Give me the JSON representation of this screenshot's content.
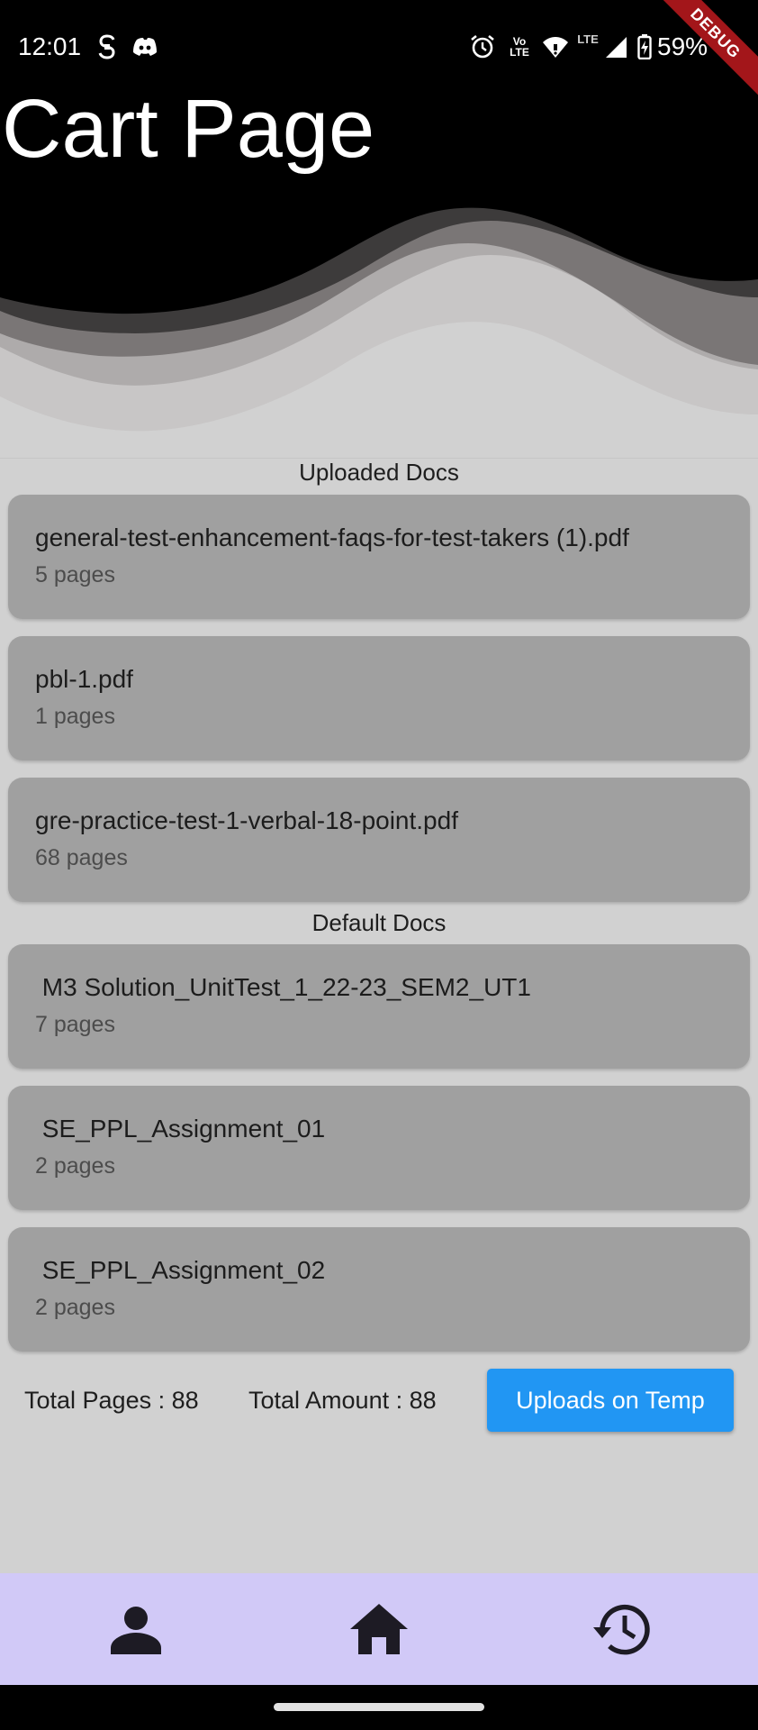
{
  "status_bar": {
    "time": "12:01",
    "battery": "59%",
    "debug_label": "DEBUG",
    "icons": [
      "s-notification-icon",
      "discord-icon",
      "alarm-icon",
      "volte-icon",
      "wifi-icon",
      "lte-icon",
      "signal-icon",
      "battery-charging-icon"
    ],
    "volte_line1": "Vo",
    "volte_line2": "LTE",
    "lte_label": "LTE"
  },
  "header": {
    "title": "Cart Page"
  },
  "uploaded": {
    "heading": "Uploaded Docs",
    "docs": [
      {
        "name": "general-test-enhancement-faqs-for-test-takers (1).pdf",
        "pages": "5 pages"
      },
      {
        "name": "pbl-1.pdf",
        "pages": "1 pages"
      },
      {
        "name": "gre-practice-test-1-verbal-18-point.pdf",
        "pages": "68 pages"
      }
    ]
  },
  "default": {
    "heading": "Default Docs",
    "docs": [
      {
        "name": " M3 Solution_UnitTest_1_22-23_SEM2_UT1",
        "pages": "7 pages"
      },
      {
        "name": " SE_PPL_Assignment_01",
        "pages": "2 pages"
      },
      {
        "name": " SE_PPL_Assignment_02",
        "pages": "2 pages"
      }
    ]
  },
  "summary": {
    "total_pages": "Total Pages : 88",
    "total_amount": "Total Amount : 88",
    "upload_button": "Uploads on Temp"
  },
  "bottom_nav": {
    "items": [
      {
        "icon": "person-icon"
      },
      {
        "icon": "home-icon"
      },
      {
        "icon": "history-icon"
      }
    ]
  },
  "colors": {
    "button": "#2196f3",
    "card": "#a0a0a0",
    "background": "#d1d1d1",
    "nav": "#d1c9f7",
    "header": "#000000"
  }
}
